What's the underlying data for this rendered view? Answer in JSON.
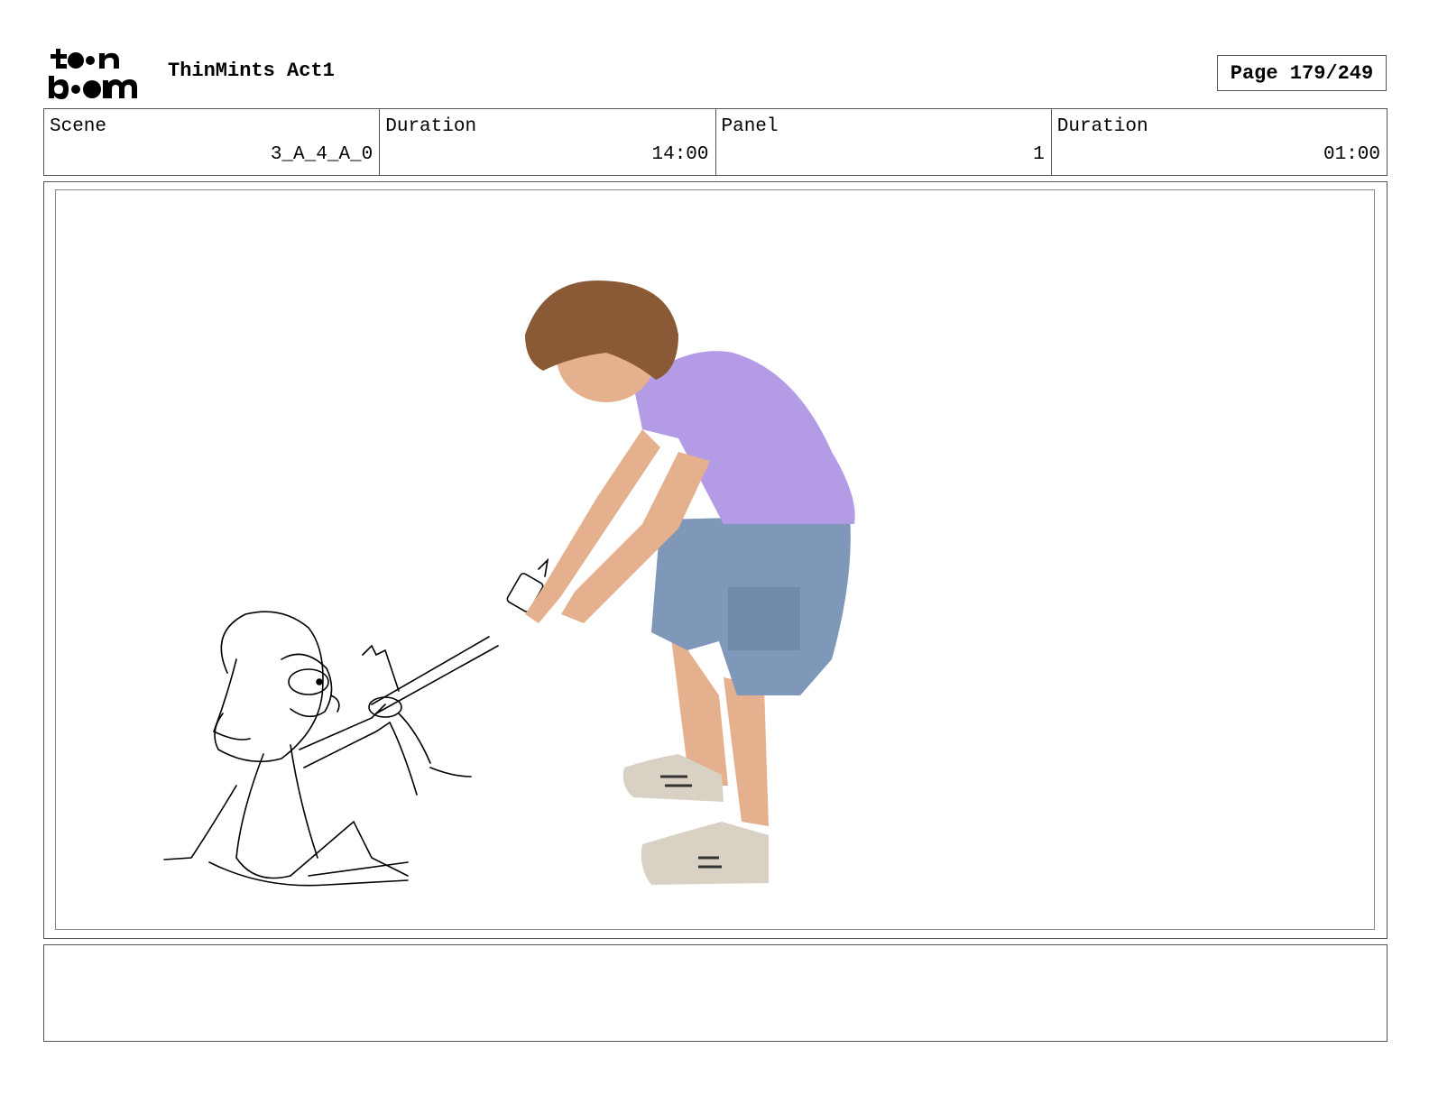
{
  "header": {
    "logo_text_top": "toon",
    "logo_text_bottom": "boom",
    "project_title": "ThinMints Act1",
    "page_label": "Page 179/249"
  },
  "info": {
    "scene_label": "Scene",
    "scene_value": "3_A_4_A_0",
    "scene_duration_label": "Duration",
    "scene_duration_value": "14:00",
    "panel_label": "Panel",
    "panel_value": "1",
    "panel_duration_label": "Duration",
    "panel_duration_value": "01:00"
  },
  "panel": {
    "image_subjects": [
      "sketch-girl-character",
      "sketch-small-creature",
      "photo-person-pulling"
    ]
  },
  "notes": {
    "text": ""
  },
  "colors": {
    "border": "#555555",
    "shirt": "#b49be6",
    "shorts": "#7f97b9",
    "hair": "#8a5a36",
    "skin": "#e5b08e",
    "shoes": "#d9d2c4"
  }
}
